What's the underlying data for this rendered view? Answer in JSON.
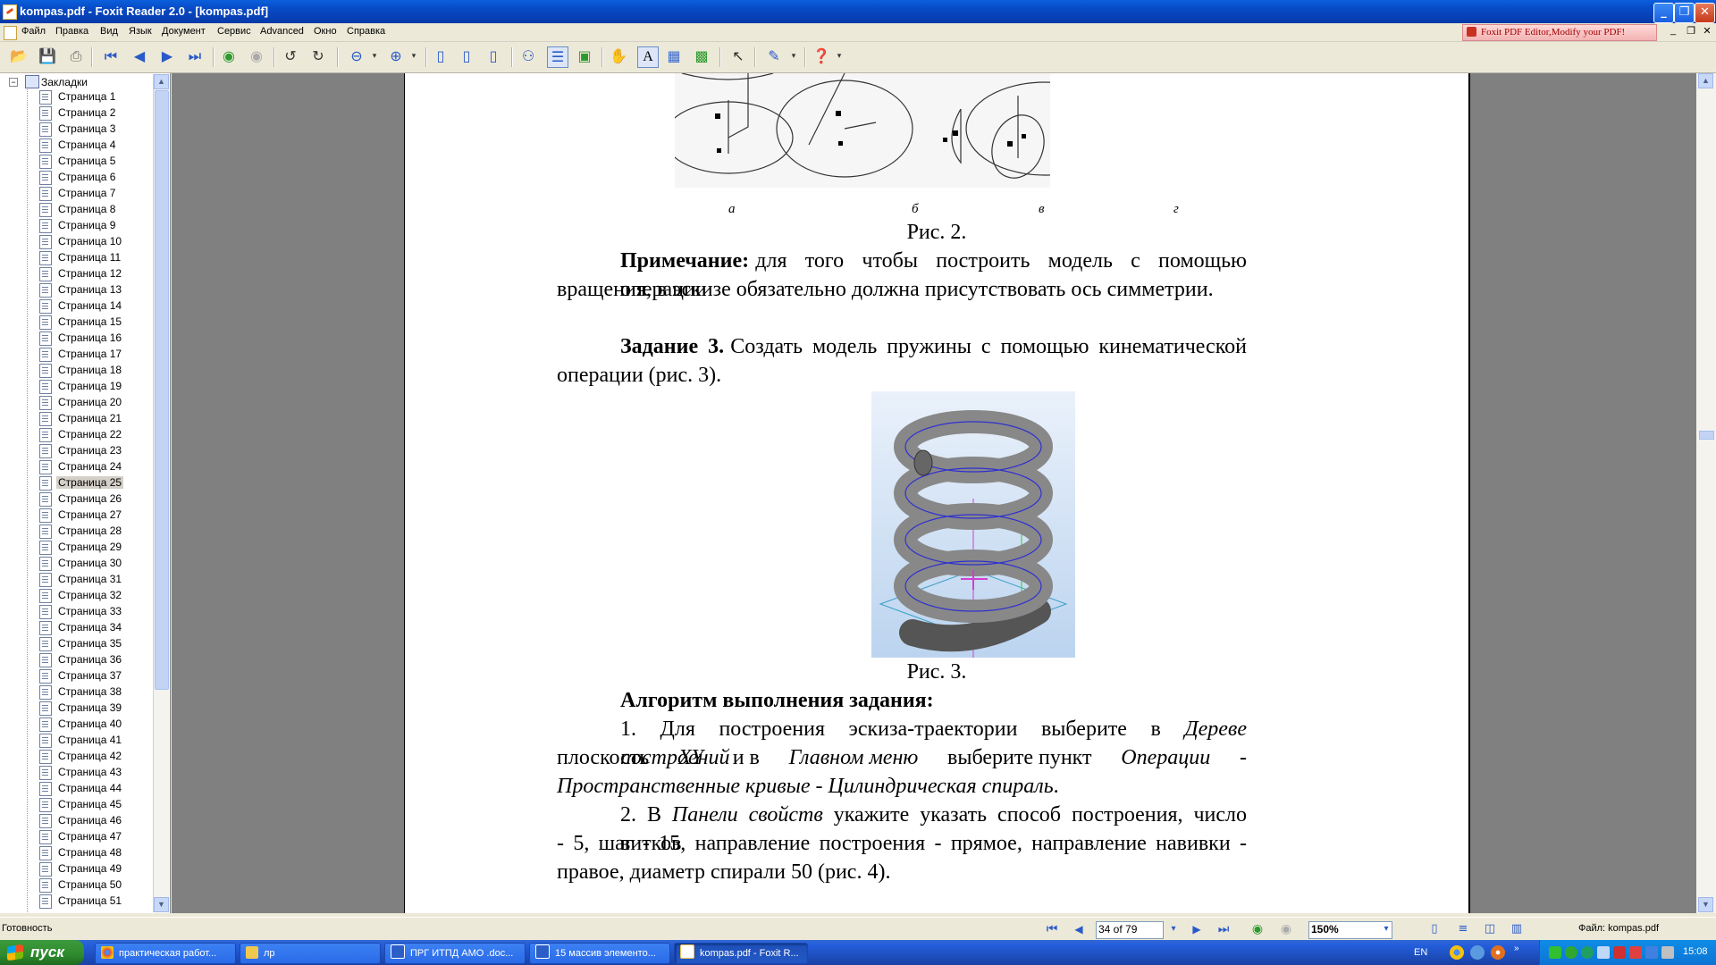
{
  "window": {
    "title": "kompas.pdf - Foxit Reader 2.0 - [kompas.pdf]",
    "controls": {
      "minimize": "_",
      "maximize": "❐",
      "close": "✕"
    }
  },
  "menu": {
    "items": [
      "Файл",
      "Правка",
      "Вид",
      "Язык",
      "Документ",
      "Сервис",
      "Advanced",
      "Окно",
      "Справка"
    ],
    "ad": "Foxit PDF Editor,Modify your PDF!",
    "mdi": {
      "minimize": "_",
      "restore": "❐",
      "close": "✕"
    }
  },
  "sidebar": {
    "root": "Закладки",
    "selected": "Страница 25",
    "items": [
      "Страница 1",
      "Страница 2",
      "Страница 3",
      "Страница 4",
      "Страница 5",
      "Страница 6",
      "Страница 7",
      "Страница 8",
      "Страница 9",
      "Страница 10",
      "Страница 11",
      "Страница 12",
      "Страница 13",
      "Страница 14",
      "Страница 15",
      "Страница 16",
      "Страница 17",
      "Страница 18",
      "Страница 19",
      "Страница 20",
      "Страница 21",
      "Страница 22",
      "Страница 23",
      "Страница 24",
      "Страница 25",
      "Страница 26",
      "Страница 27",
      "Страница 28",
      "Страница 29",
      "Страница 30",
      "Страница 31",
      "Страница 32",
      "Страница 33",
      "Страница 34",
      "Страница 35",
      "Страница 36",
      "Страница 37",
      "Страница 38",
      "Страница 39",
      "Страница 40",
      "Страница 41",
      "Страница 42",
      "Страница 43",
      "Страница 44",
      "Страница 45",
      "Страница 46",
      "Страница 47",
      "Страница 48",
      "Страница 49",
      "Страница 50",
      "Страница 51"
    ]
  },
  "document": {
    "fig2_sublabels": [
      "а",
      "б",
      "в",
      "г"
    ],
    "fig2_caption": "Рис. 2.",
    "note_bold": "Примечание:",
    "note_line1": "для того чтобы построить модель с помощью операции",
    "note_line2": "вращения, в эскизе обязательно должна присутствовать ось симметрии.",
    "task_bold": "Задание 3.",
    "task_line1": "Создать модель пружины с помощью кинематической",
    "task_line2": "операции (рис. 3).",
    "fig3_caption": "Рис. 3.",
    "algo_heading": "Алгоритм выполнения задания:",
    "step1_l1a": "1. Для построения эскиза-траектории выберите в",
    "step1_l1b": "Дереве построений",
    "step1_l2a": "плоскость",
    "step1_l2b": "XY",
    "step1_l2c": "и в",
    "step1_l2d": "Главном меню",
    "step1_l2e": "выберите пункт",
    "step1_l2f": "Операции",
    "step1_l2g": "-",
    "step1_l3": "Пространственные кривые - Цилиндрическая спираль",
    "step1_l3end": ".",
    "step2_l1a": "2. В",
    "step2_l1b": "Панели свойств",
    "step2_l1c": "укажите указать способ построения, число витков",
    "step2_l2": "- 5, шаг - 15, направление построения - прямое, направление навивки -",
    "step2_l3": "правое, диаметр спирали 50 (рис. 4)."
  },
  "status": {
    "ready": "Готовность",
    "page": "34 of 79",
    "zoom": "150%",
    "file": "Файл: kompas.pdf"
  },
  "taskbar": {
    "start": "пуск",
    "buttons": [
      "практическая работ...",
      "лр",
      "ПРГ ИТПД  АМО .doc...",
      "15 массив элементо...",
      "kompas.pdf - Foxit R..."
    ],
    "lang": "EN",
    "clock": "15:08"
  },
  "colors": {
    "accent": "#0a5fdc",
    "page_bg": "#ffffff",
    "workspace": "#808080",
    "taskbar": "#245edb",
    "start": "#2e8a2e"
  }
}
